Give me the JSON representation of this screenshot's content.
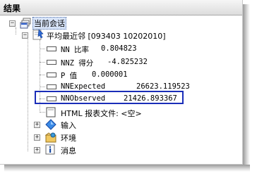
{
  "panel": {
    "title": "结果"
  },
  "tree": {
    "session_label": "当前会话",
    "tool_label": "平均最近邻 [093403 10202010]",
    "results": [
      {
        "name": "NN 比率",
        "value": "0.804823"
      },
      {
        "name": "NNZ 得分",
        "value": "-4.825232"
      },
      {
        "name": "P 值",
        "value": "0.000001"
      },
      {
        "name": "NNExpected",
        "value": "26623.119523"
      },
      {
        "name": "NNObserved",
        "value": "21426.893367"
      }
    ],
    "html_report": "HTML 报表文件: <空>",
    "inputs_label": "输入",
    "env_label": "环境",
    "messages_label": "消息"
  },
  "colors": {
    "highlight_border": "#1a2db8",
    "selection_bg": "#d8e4f8"
  },
  "icons": [
    "session-icon",
    "tool-icon",
    "value-icon",
    "html-report-icon",
    "diamond-icon",
    "environment-icon",
    "info-icon"
  ]
}
